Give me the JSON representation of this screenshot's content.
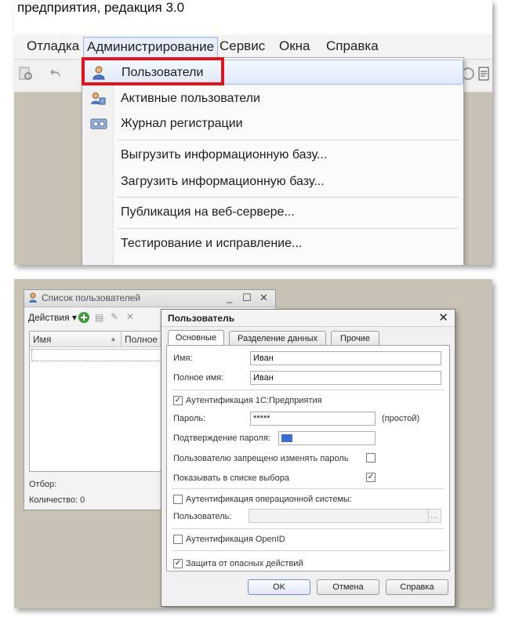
{
  "app": {
    "title_partial": "предприятия, редакция 3.0"
  },
  "menubar": {
    "items": [
      {
        "label": "Отладка"
      },
      {
        "label": "Администрирование"
      },
      {
        "label": "Сервис"
      },
      {
        "label": "Окна"
      },
      {
        "label": "Справка"
      }
    ]
  },
  "admin_menu": {
    "items": [
      {
        "label": "Пользователи",
        "icon": "user-icon",
        "highlighted": true
      },
      {
        "label": "Активные пользователи",
        "icon": "active-users-icon"
      },
      {
        "label": "Журнал регистрации",
        "icon": "registration-log-icon"
      },
      {
        "label": "Выгрузить информационную базу..."
      },
      {
        "label": "Загрузить информационную базу..."
      },
      {
        "label": "Публикация на веб-сервере..."
      },
      {
        "label": "Тестирование и исправление..."
      }
    ]
  },
  "user_list_window": {
    "title": "Список пользователей",
    "actions_label": "Действия",
    "columns": [
      "Имя",
      "Полное н"
    ],
    "filter_label": "Отбор:",
    "count_label": "Количество: 0"
  },
  "user_dialog": {
    "title": "Пользователь",
    "tabs": [
      {
        "label": "Основные",
        "active": true
      },
      {
        "label": "Разделение данных"
      },
      {
        "label": "Прочие"
      }
    ],
    "name_label": "Имя:",
    "name_value": "Иван",
    "fullname_label": "Полное имя:",
    "fullname_value": "Иван",
    "auth_1c_label": "Аутентификация 1С:Предприятия",
    "auth_1c_checked": true,
    "password_label": "Пароль:",
    "password_value": "*****",
    "password_hint": "(простой)",
    "confirm_label": "Подтверждение пароля:",
    "deny_change_label": "Пользователю запрещено изменять пароль",
    "deny_change_checked": false,
    "show_in_list_label": "Показывать в списке выбора",
    "show_in_list_checked": true,
    "auth_os_label": "Аутентификация операционной системы:",
    "auth_os_checked": false,
    "os_user_label": "Пользователь:",
    "os_user_button": "...",
    "auth_openid_label": "Аутентификация OpenID",
    "auth_openid_checked": false,
    "protect_label": "Защита от опасных действий",
    "protect_checked": true,
    "buttons": {
      "ok": "OK",
      "cancel": "Отмена",
      "help": "Справка"
    }
  },
  "colors": {
    "highlight_border": "#e0141e",
    "workspace": "#c8c2b4"
  }
}
